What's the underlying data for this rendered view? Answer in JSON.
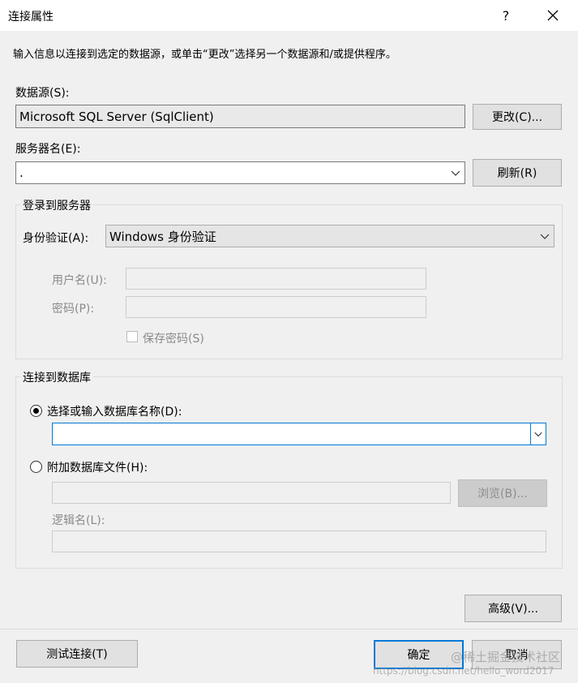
{
  "window": {
    "title": "连接属性",
    "help": "?",
    "close": "✕"
  },
  "instruction": "输入信息以连接到选定的数据源，或单击“更改”选择另一个数据源和/或提供程序。",
  "data_source": {
    "label": "数据源(S):",
    "value": "Microsoft SQL Server (SqlClient)",
    "change_button": "更改(C)..."
  },
  "server": {
    "label": "服务器名(E):",
    "value": ".",
    "refresh_button": "刷新(R)"
  },
  "login_group": {
    "title": "登录到服务器",
    "auth_label": "身份验证(A):",
    "auth_value": "Windows 身份验证",
    "username_label": "用户名(U):",
    "password_label": "密码(P):",
    "save_password_label": "保存密码(S)"
  },
  "database_group": {
    "title": "连接到数据库",
    "select_db_label": "选择或输入数据库名称(D):",
    "select_db_value": "",
    "attach_file_label": "附加数据库文件(H):",
    "browse_button": "浏览(B)...",
    "logical_name_label": "逻辑名(L):"
  },
  "advanced_button": "高级(V)...",
  "test_button": "测试连接(T)",
  "ok_button": "确定",
  "cancel_button": "取消",
  "watermark": "@稀土掘金技术社区",
  "watermark2": "https://blog.csdn.net/hello_word2017"
}
